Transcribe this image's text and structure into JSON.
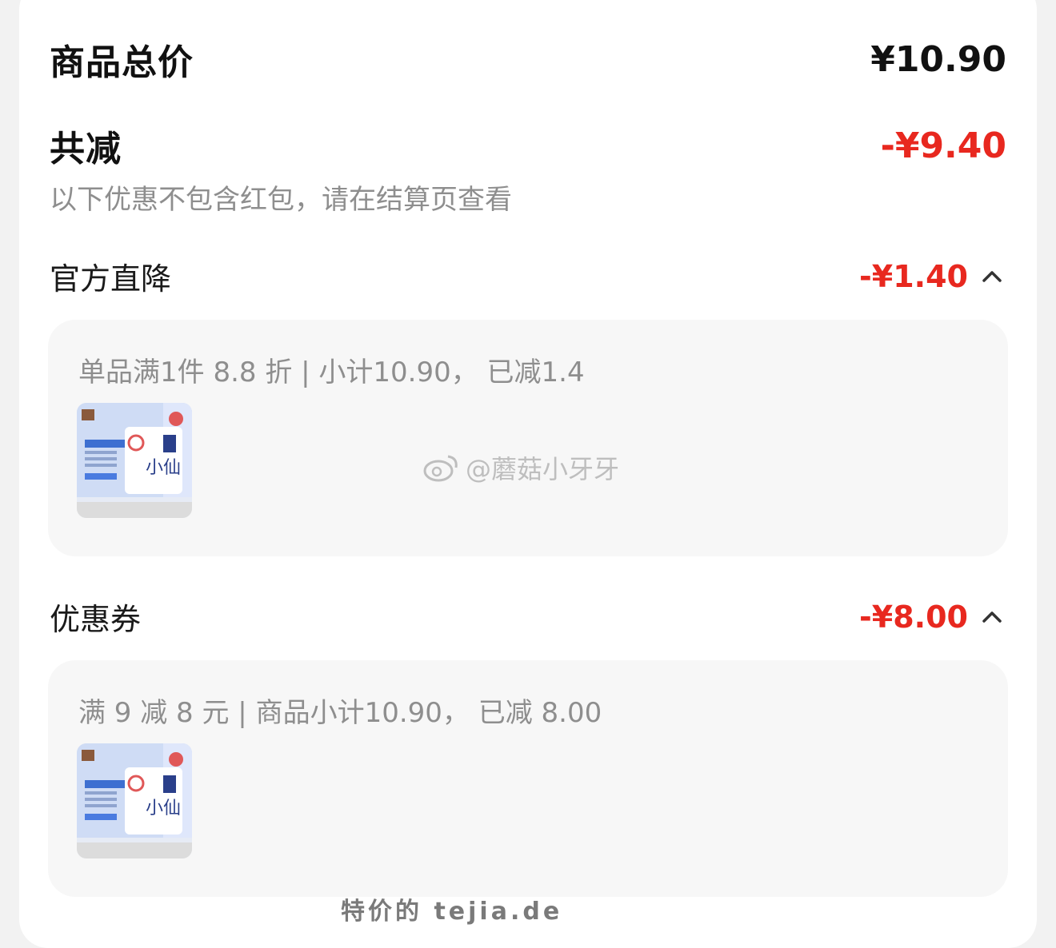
{
  "summary": {
    "total_label": "商品总价",
    "total_value": "¥10.90",
    "reduce_label": "共减",
    "reduce_value": "-¥9.40",
    "note": "以下优惠不包含红包，请在结算页查看"
  },
  "sections": [
    {
      "label": "官方直降",
      "value": "-¥1.40",
      "detail": "单品满1件 8.8 折 | 小计10.90， 已减1.4"
    },
    {
      "label": "优惠券",
      "value": "-¥8.00",
      "detail": "满 9 减 8 元 | 商品小计10.90， 已减 8.00"
    }
  ],
  "watermark": "@蘑菇小牙牙",
  "footer": "特价的 tejia.de",
  "colors": {
    "accent_red": "#e8281f",
    "panel_bg": "#f7f7f7"
  }
}
